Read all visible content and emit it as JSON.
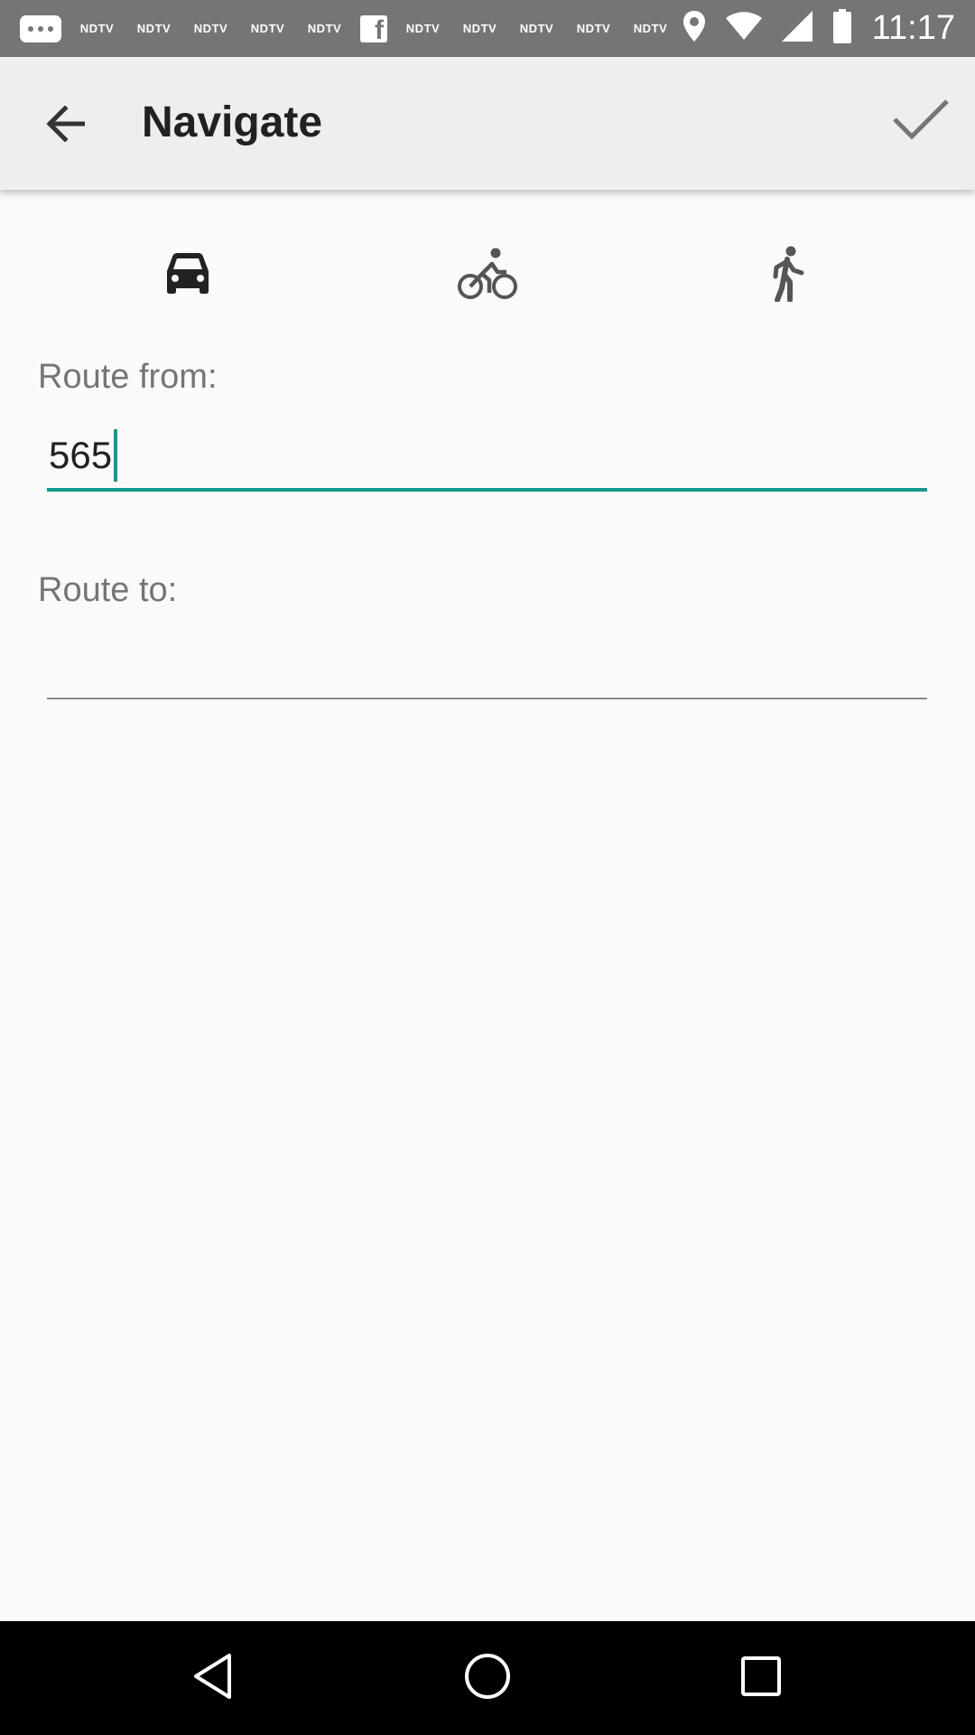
{
  "status_bar": {
    "notifications": [
      "NDTV",
      "NDTV",
      "NDTV",
      "NDTV",
      "NDTV",
      "NDTV",
      "NDTV",
      "NDTV",
      "NDTV",
      "NDTV"
    ],
    "time": "11:17",
    "icons": [
      "chat-icon",
      "facebook-icon",
      "location-icon",
      "wifi-icon",
      "signal-icon",
      "battery-icon"
    ]
  },
  "app_bar": {
    "title": "Navigate",
    "back_icon": "arrow-back-icon",
    "confirm_icon": "check-icon"
  },
  "modes": [
    {
      "name": "car",
      "icon": "car-icon"
    },
    {
      "name": "bicycle",
      "icon": "bicycle-icon"
    },
    {
      "name": "walk",
      "icon": "walk-icon"
    }
  ],
  "form": {
    "from_label": "Route from:",
    "from_value": "565",
    "to_label": "Route to:",
    "to_value": ""
  },
  "nav_bar": {
    "icons": [
      "nav-back-icon",
      "nav-home-icon",
      "nav-recents-icon"
    ]
  },
  "colors": {
    "accent": "#139a8e",
    "status_bar": "#757575",
    "app_bar": "#eeeeee",
    "icon": "#555555"
  }
}
